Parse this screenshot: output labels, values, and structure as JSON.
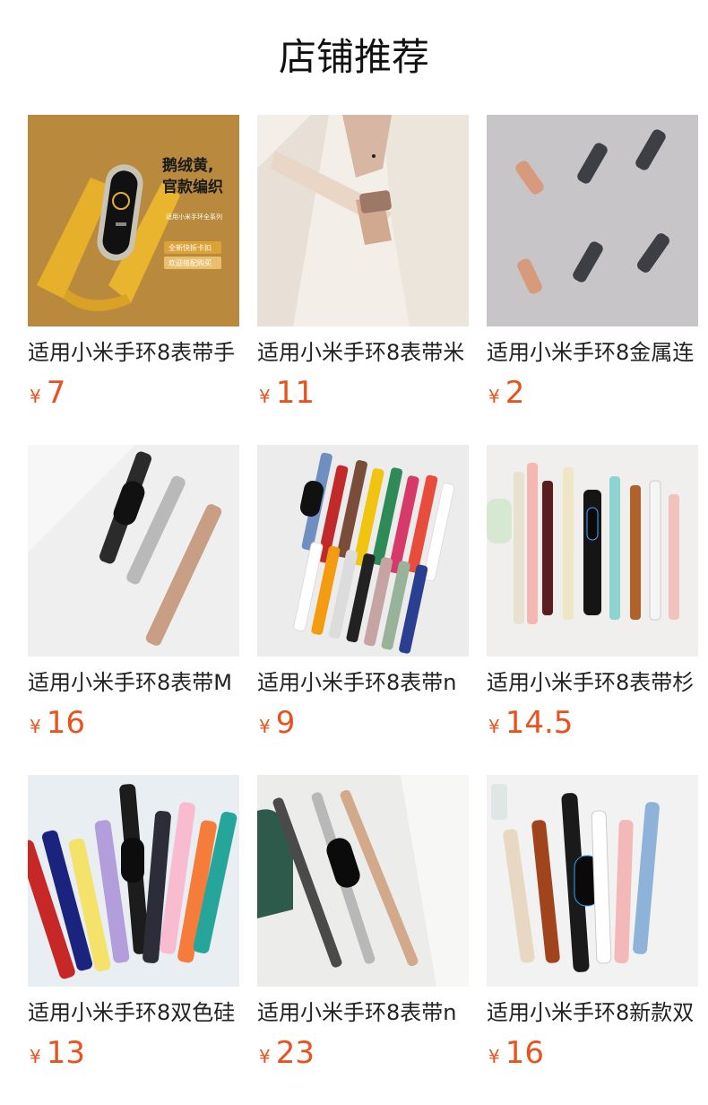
{
  "section_title": "店铺推荐",
  "currency_symbol": "¥",
  "products": [
    {
      "name": "适用小米手环8表带手",
      "price": "7",
      "overlay": {
        "line1": "鹅绒黄,",
        "line2": "官款编织",
        "tag1": "适用小米手环全系列",
        "tag2": "全新快拆卡扣",
        "tag3": "欢迎搭配购买"
      }
    },
    {
      "name": "适用小米手环8表带米",
      "price": "11"
    },
    {
      "name": "适用小米手环8金属连",
      "price": "2"
    },
    {
      "name": "适用小米手环8表带M",
      "price": "16"
    },
    {
      "name": "适用小米手环8表带n",
      "price": "9"
    },
    {
      "name": "适用小米手环8表带杉",
      "price": "14.5"
    },
    {
      "name": "适用小米手环8双色硅",
      "price": "13"
    },
    {
      "name": "适用小米手环8表带n",
      "price": "23"
    },
    {
      "name": "适用小米手环8新款双",
      "price": "16"
    }
  ]
}
